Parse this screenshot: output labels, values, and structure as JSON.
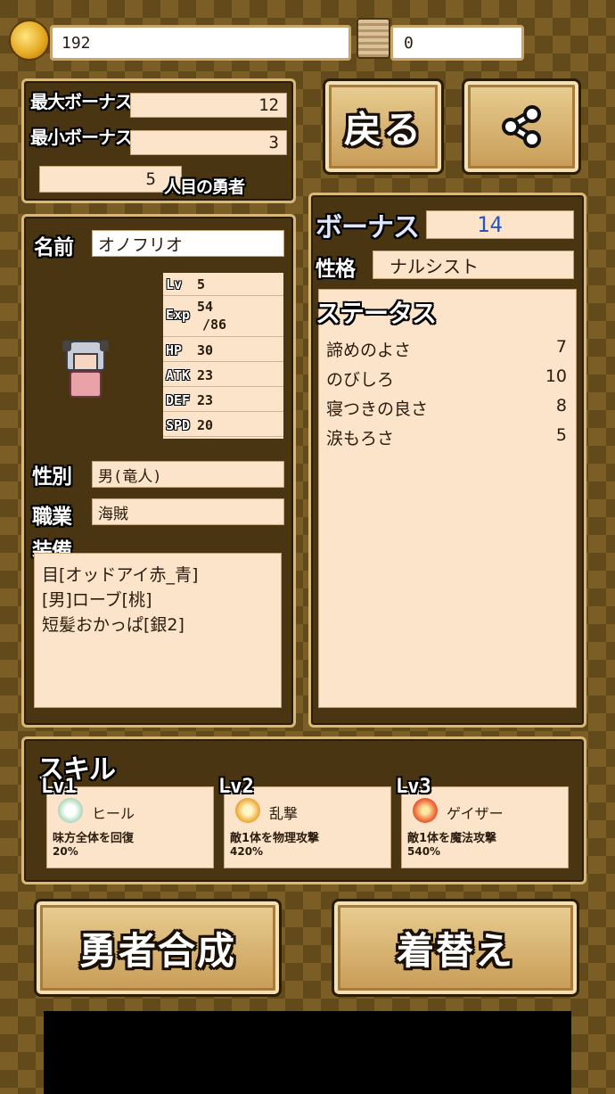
{
  "top": {
    "coins": "192",
    "tickets": "0"
  },
  "bonus_box": {
    "max_label": "最大ボーナス",
    "max_value": "12",
    "min_label": "最小ボーナス",
    "min_value": "3",
    "count": "5",
    "count_label": "人目の勇者"
  },
  "buttons": {
    "back": "戻る",
    "synthesize": "勇者合成",
    "dress_up": "着替え"
  },
  "hero": {
    "name_label": "名前",
    "name": "オノフリオ",
    "stats": [
      {
        "key": "Lv",
        "value": "5"
      },
      {
        "key": "Exp",
        "value": "54",
        "value2": "/86"
      },
      {
        "key": "HP",
        "value": "30"
      },
      {
        "key": "ATK",
        "value": "23"
      },
      {
        "key": "DEF",
        "value": "23"
      },
      {
        "key": "SPD",
        "value": "20"
      }
    ],
    "gender_label": "性別",
    "gender": "男(竜人)",
    "job_label": "職業",
    "job": "海賊",
    "equip_label": "装備",
    "equipment": [
      "目[オッドアイ赤_青]",
      "[男]ローブ[桃]",
      "短髪おかっぱ[銀2]"
    ]
  },
  "right": {
    "bonus_label": "ボーナス",
    "bonus_value": "14",
    "personality_label": "性格",
    "personality": "ナルシスト",
    "status_label": "ステータス",
    "status": [
      {
        "name": "諦めのよさ",
        "value": "7"
      },
      {
        "name": "のびしろ",
        "value": "10"
      },
      {
        "name": "寝つきの良さ",
        "value": "8"
      },
      {
        "name": "涙もろさ",
        "value": "5"
      }
    ]
  },
  "skills": {
    "title": "スキル",
    "items": [
      {
        "level": "Lv1",
        "name": "ヒール",
        "desc": "味方全体を回復",
        "power": "20%",
        "icon": "heal-icon",
        "color": "#bfe3c8"
      },
      {
        "level": "Lv2",
        "name": "乱撃",
        "desc": "敵1体を物理攻撃",
        "power": "420%",
        "icon": "slash-icon",
        "color": "#f1b54a"
      },
      {
        "level": "Lv3",
        "name": "ゲイザー",
        "desc": "敵1体を魔法攻撃",
        "power": "540%",
        "icon": "fire-icon",
        "color": "#ef6a3a"
      }
    ]
  },
  "colors": {
    "accent_number": "#2a56b8",
    "panel_bg": "#4a3512",
    "field_bg": "#fbe4c9"
  }
}
